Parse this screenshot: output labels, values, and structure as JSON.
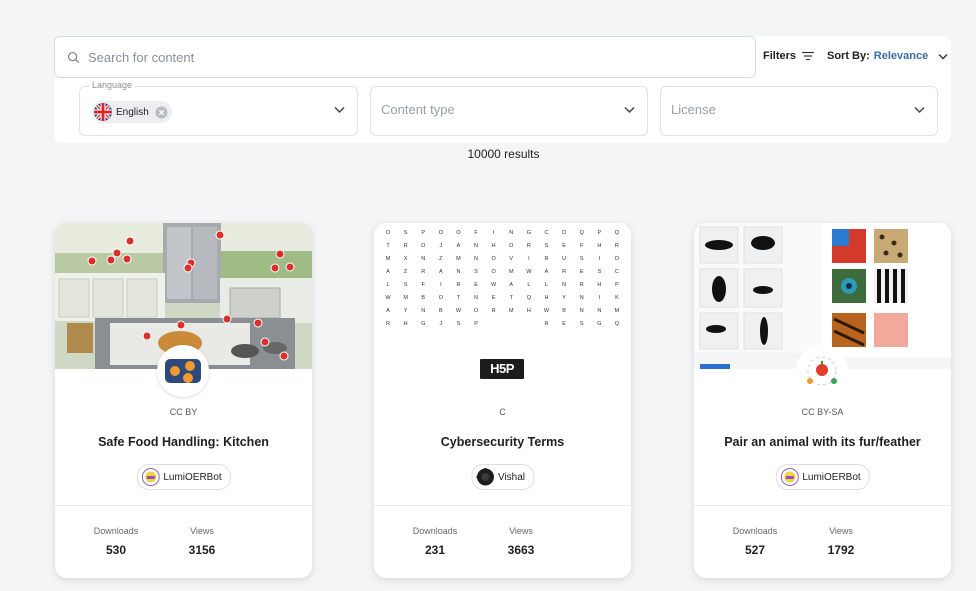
{
  "search": {
    "placeholder": "Search for content"
  },
  "toolbar": {
    "filters_label": "Filters",
    "sort_prefix": "Sort By:",
    "sort_value": "Relevance"
  },
  "dropdowns": {
    "language": {
      "label": "Language",
      "chip": "English"
    },
    "content_type": {
      "placeholder": "Content type"
    },
    "license": {
      "placeholder": "License"
    }
  },
  "results_text": "10000 results",
  "cards": [
    {
      "license": "CC BY",
      "title": "Safe Food Handling: Kitchen",
      "author": "LumiOERBot",
      "downloads_label": "Downloads",
      "downloads": "530",
      "views_label": "Views",
      "views": "3156"
    },
    {
      "license": "C",
      "title": "Cybersecurity Terms",
      "author": "Vishal",
      "downloads_label": "Downloads",
      "downloads": "231",
      "views_label": "Views",
      "views": "3663",
      "wordsearch_rows": [
        "O S P O O F I N G C D Q P Q",
        "T R O J A N H O R S E F H R",
        "M X N Z M N O V I R U S I O",
        "A Z R A N S O M W A R E S C",
        "L S F I R E W A L L N R H P",
        "W M B O T N E T Q H Y N I K",
        "A Y N B W O R M H W B N N M",
        "R H G J S P . . . R E S G Q"
      ],
      "logo_text": "H5P"
    },
    {
      "license": "CC BY-SA",
      "title": "Pair an animal with its fur/feather",
      "author": "LumiOERBot",
      "downloads_label": "Downloads",
      "downloads": "527",
      "views_label": "Views",
      "views": "1792"
    }
  ]
}
